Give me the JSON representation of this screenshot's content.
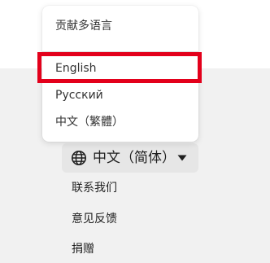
{
  "language_menu": {
    "header": "贡献多语言",
    "items": [
      {
        "label": "English",
        "highlighted": true
      },
      {
        "label": "Русский"
      },
      {
        "label": "中文（繁體）"
      }
    ]
  },
  "language_selector": {
    "current": "中文（简体）",
    "icon": "globe-icon",
    "caret": "caret-down-icon"
  },
  "footer_links": [
    {
      "label": "联系我们"
    },
    {
      "label": "意见反馈"
    },
    {
      "label": "捐赠"
    }
  ],
  "colors": {
    "highlight": "#e3001b",
    "footer_background": "#f1f1f1",
    "selector_background": "#e6e6e6"
  }
}
